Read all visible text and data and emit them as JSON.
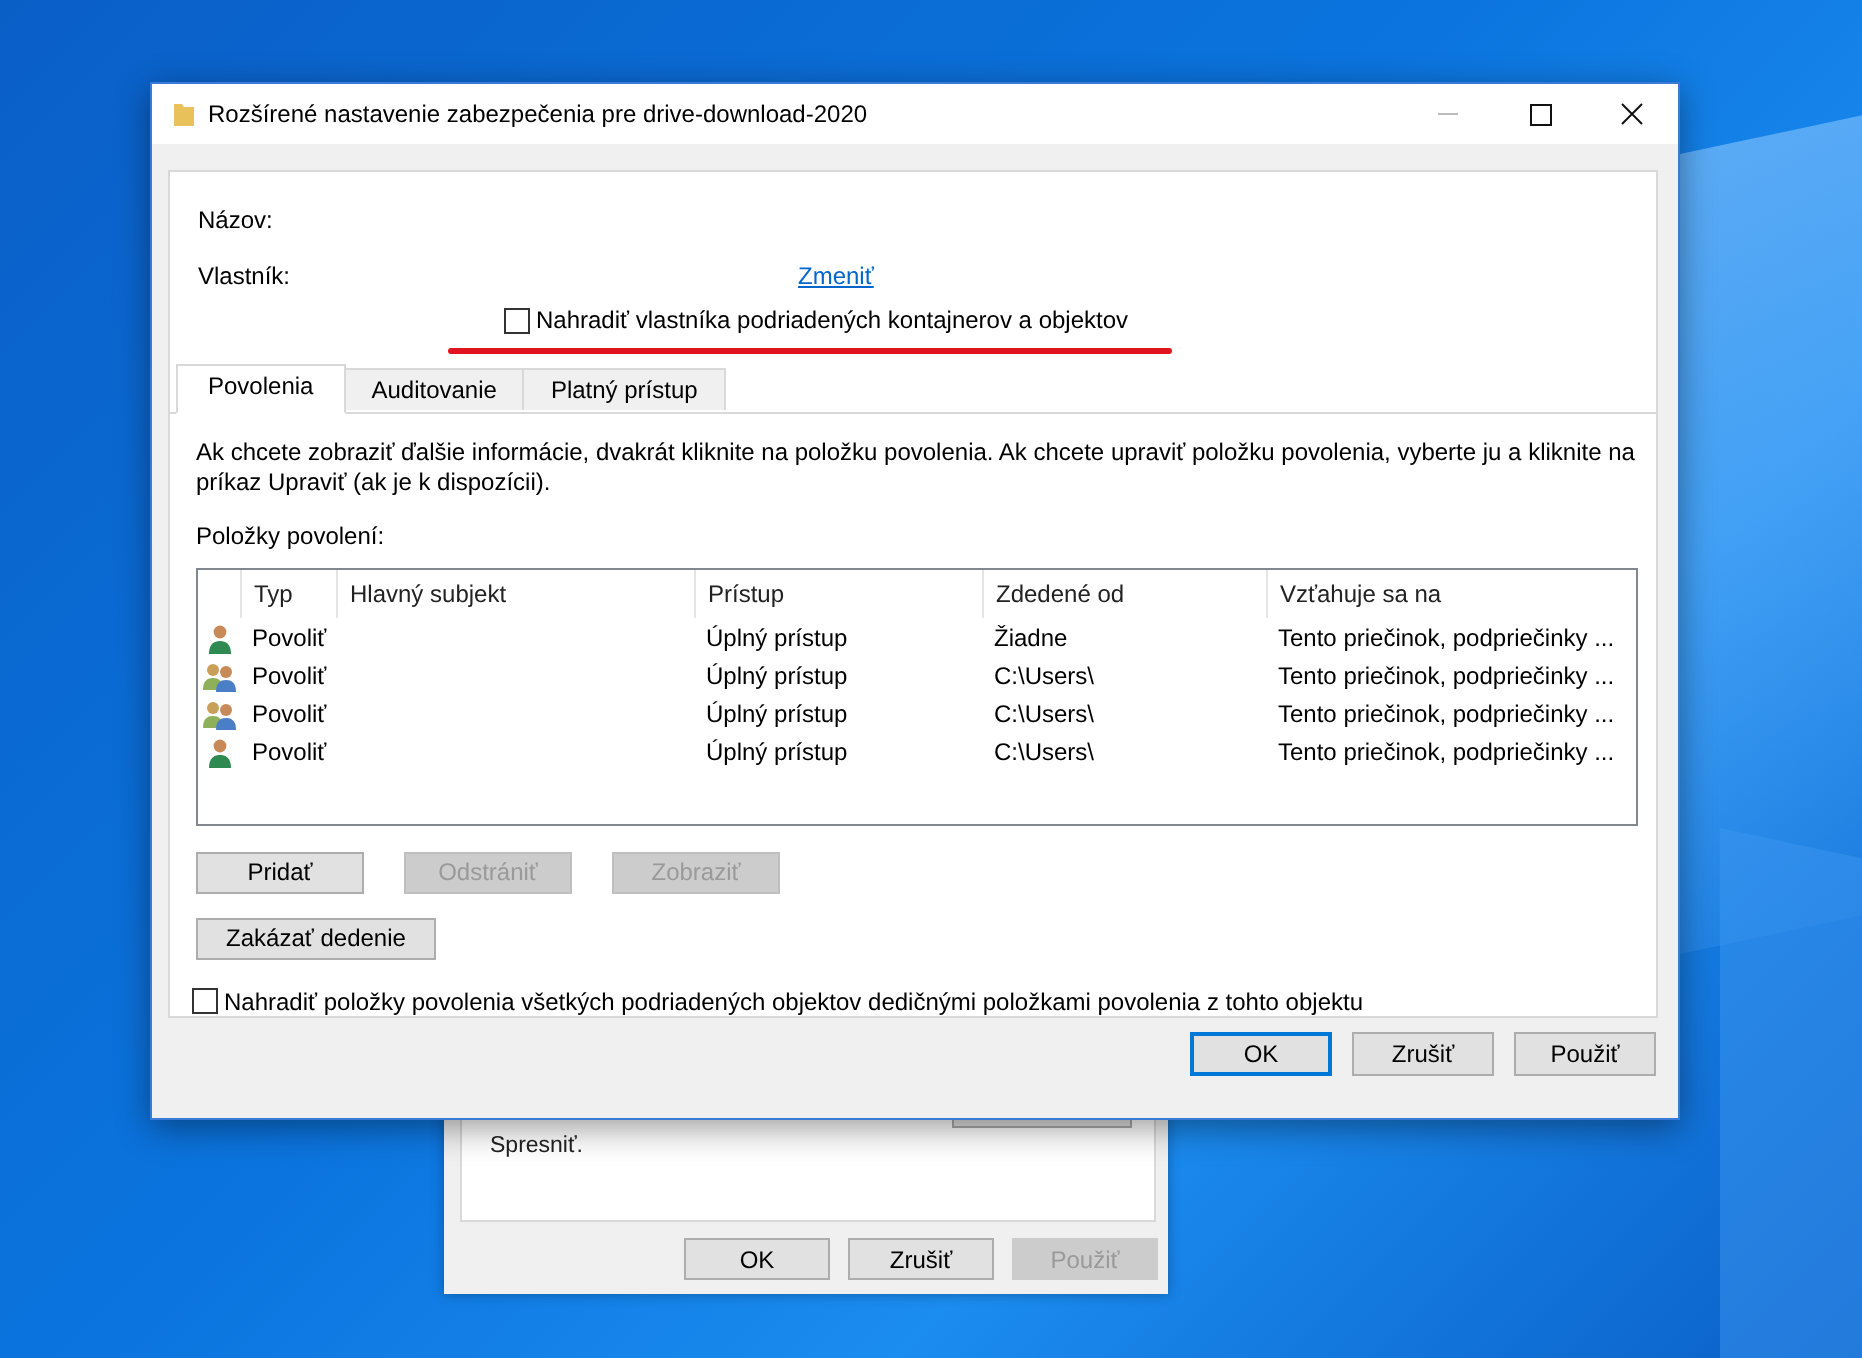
{
  "background_window": {
    "text_lines": [
      "Spresniť."
    ],
    "buttons": [
      {
        "label": "OK",
        "disabled": false
      },
      {
        "label": "Zrušiť",
        "disabled": false
      },
      {
        "label": "Použiť",
        "disabled": true
      }
    ]
  },
  "window": {
    "title": "Rozšírené nastavenie zabezpečenia pre drive-download-2020"
  },
  "name_label": "Názov:",
  "owner_label": "Vlastník:",
  "change_link": "Zmeniť",
  "replace_owner": {
    "label": "Nahradiť vlastníka podriadených kontajnerov a objektov",
    "checked": false
  },
  "tabs": [
    {
      "label": "Povolenia",
      "selected": true
    },
    {
      "label": "Auditovanie",
      "selected": false
    },
    {
      "label": "Platný prístup",
      "selected": false
    }
  ],
  "info_text": "Ak chcete zobraziť ďalšie informácie, dvakrát kliknite na položku povolenia. Ak chcete upraviť položku povolenia, vyberte ju a kliknite na príkaz Upraviť (ak je k dispozícii).",
  "entries_label": "Položky povolení:",
  "table": {
    "columns": [
      "Typ",
      "Hlavný subjekt",
      "Prístup",
      "Zdedené od",
      "Vzťahuje sa na"
    ],
    "rows": [
      {
        "kind": "user",
        "type": "Povoliť",
        "access": "Úplný prístup",
        "inherited_from": "Žiadne",
        "applies_to": "Tento priečinok, podpriečinky ..."
      },
      {
        "kind": "group",
        "type": "Povoliť",
        "access": "Úplný prístup",
        "inherited_from": "C:\\Users\\",
        "applies_to": "Tento priečinok, podpriečinky ..."
      },
      {
        "kind": "group",
        "type": "Povoliť",
        "access": "Úplný prístup",
        "inherited_from": "C:\\Users\\",
        "applies_to": "Tento priečinok, podpriečinky ..."
      },
      {
        "kind": "user",
        "type": "Povoliť",
        "access": "Úplný prístup",
        "inherited_from": "C:\\Users\\",
        "applies_to": "Tento priečinok, podpriečinky ..."
      }
    ]
  },
  "entry_buttons": [
    {
      "label": "Pridať",
      "disabled": false
    },
    {
      "label": "Odstrániť",
      "disabled": true
    },
    {
      "label": "Zobraziť",
      "disabled": true
    }
  ],
  "disable_inheritance_button": "Zakázať dedenie",
  "replace_entries": {
    "label": "Nahradiť položky povolenia všetkých podriadených objektov dedičnými položkami povolenia z tohto objektu",
    "checked": false
  },
  "dialog_buttons": [
    {
      "label": "OK",
      "default": true
    },
    {
      "label": "Zrušiť",
      "default": false
    },
    {
      "label": "Použiť",
      "default": false
    }
  ]
}
